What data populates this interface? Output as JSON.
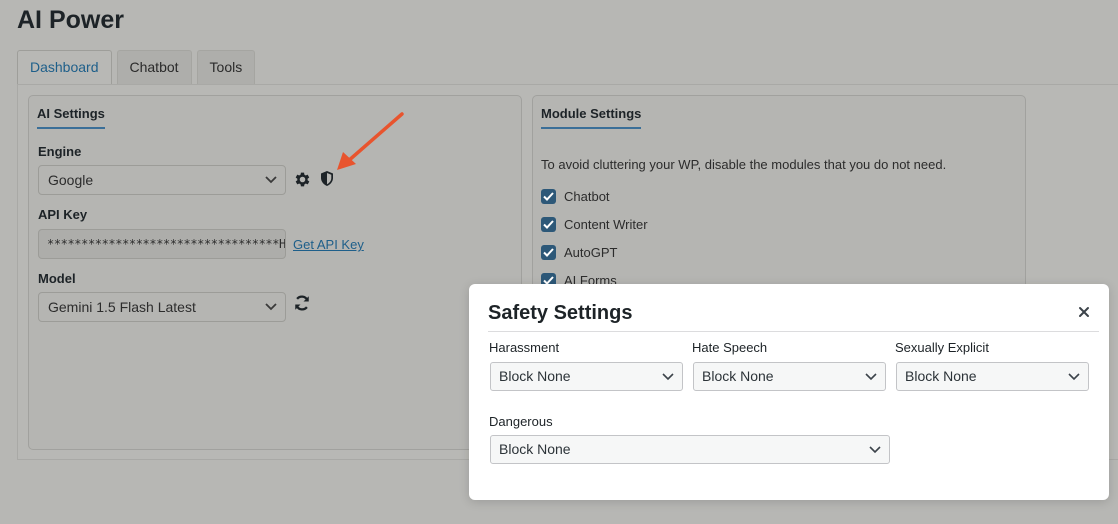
{
  "app": {
    "title": "AI Power"
  },
  "tabs": [
    {
      "label": "Dashboard",
      "active": true
    },
    {
      "label": "Chatbot",
      "active": false
    },
    {
      "label": "Tools",
      "active": false
    }
  ],
  "ai_settings": {
    "title": "AI Settings",
    "engine_label": "Engine",
    "engine_value": "Google",
    "api_key_label": "API Key",
    "api_key_value": "**********************************H",
    "get_api_key_link": "Get API Key",
    "model_label": "Model",
    "model_value": "Gemini 1.5 Flash Latest"
  },
  "module_settings": {
    "title": "Module Settings",
    "description": "To avoid cluttering your WP, disable the modules that you do not need.",
    "modules": [
      {
        "label": "Chatbot",
        "checked": true
      },
      {
        "label": "Content Writer",
        "checked": true
      },
      {
        "label": "AutoGPT",
        "checked": true
      },
      {
        "label": "AI Forms",
        "checked": true
      }
    ]
  },
  "safety_modal": {
    "title": "Safety Settings",
    "harassment_label": "Harassment",
    "harassment_value": "Block None",
    "hate_speech_label": "Hate Speech",
    "hate_speech_value": "Block None",
    "sexually_explicit_label": "Sexually Explicit",
    "sexually_explicit_value": "Block None",
    "dangerous_label": "Dangerous",
    "dangerous_value": "Block None"
  },
  "colors": {
    "accent": "#1e5f8a",
    "annotation_arrow": "#e8542e",
    "overlay_bg": "#b7b7b4",
    "modal_bg": "#ffffff"
  }
}
